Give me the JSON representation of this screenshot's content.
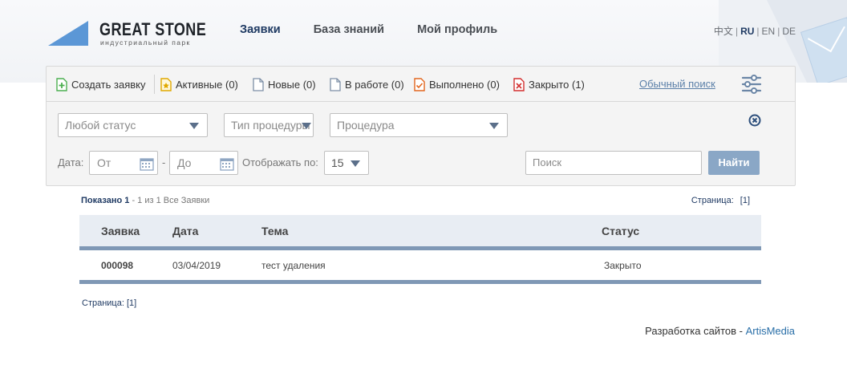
{
  "header": {
    "logo_title": "GREAT STONE",
    "logo_subtitle": "индустриальный парк",
    "nav": [
      {
        "label": "Заявки",
        "active": true
      },
      {
        "label": "База знаний",
        "active": false
      },
      {
        "label": "Мой профиль",
        "active": false
      }
    ],
    "languages": [
      "中文",
      "RU",
      "EN",
      "DE"
    ],
    "active_language": "RU",
    "separator": "|"
  },
  "toolbar": {
    "create": "Создать заявку",
    "active": "Активные (0)",
    "new": "Новые (0)",
    "in_progress": "В работе (0)",
    "done": "Выполнено (0)",
    "closed": "Закрыто (1)",
    "plain_search": "Обычный поиск",
    "icons": [
      "add-document-icon",
      "star-document-icon",
      "document-icon",
      "document-icon",
      "check-document-icon",
      "x-document-icon",
      "sliders-icon"
    ]
  },
  "filters": {
    "status_select": "Любой статус",
    "procedure_type_select": "Тип процедуры",
    "procedure_select": "Процедура",
    "date_label": "Дата:",
    "date_from_placeholder": "От",
    "date_dash": "-",
    "date_to_placeholder": "До",
    "per_page_label": "Отображать по:",
    "per_page_value": "15",
    "search_placeholder": "Поиск",
    "find_button": "Найти"
  },
  "results": {
    "shown_label": "Показано",
    "shown_count": "1",
    "shown_rest": "- 1 из 1 Все Заявки",
    "page_label": "Страница:",
    "page_current": "[1]",
    "columns": [
      "Заявка",
      "Дата",
      "Тема",
      "Статус"
    ],
    "rows": [
      {
        "id": "000098",
        "date": "03/04/2019",
        "subject": "тест удаления",
        "status": "Закрыто"
      }
    ],
    "bottom_page_label": "Страница:",
    "bottom_page_current": "[1]"
  },
  "footer": {
    "text": "Разработка сайтов -",
    "link": "ArtisMedia"
  },
  "colors": {
    "accent": "#1f3a63",
    "button": "#8aa7c6",
    "table_bar": "#7f98b5",
    "logo_blue": "#5b97d6"
  }
}
